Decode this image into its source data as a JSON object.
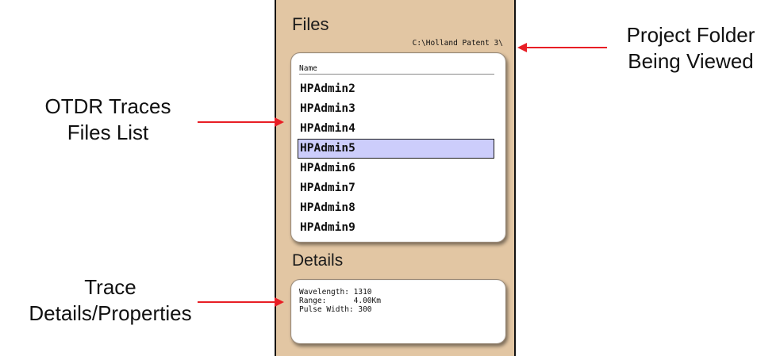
{
  "files_panel": {
    "title": "Files",
    "folder_path": "C:\\Holland Patent 3\\",
    "column_header": "Name",
    "files": [
      "HPAdmin2",
      "HPAdmin3",
      "HPAdmin4",
      "HPAdmin5",
      "HPAdmin6",
      "HPAdmin7",
      "HPAdmin8",
      "HPAdmin9"
    ],
    "selected_file": "HPAdmin5"
  },
  "details_panel": {
    "title": "Details",
    "wavelength_line": "Wavelength: 1310",
    "range_line": "Range:      4.00Km",
    "pulse_width_line": "Pulse Width: 300"
  },
  "annotations": {
    "project_folder": "Project Folder\nBeing Viewed",
    "traces_list": "OTDR Traces\nFiles List",
    "trace_details": "Trace\nDetails/Properties"
  },
  "colors": {
    "panel_bg": "#e2c6a3",
    "selected_row": "#cccdfb",
    "arrow": "#e81e25"
  }
}
